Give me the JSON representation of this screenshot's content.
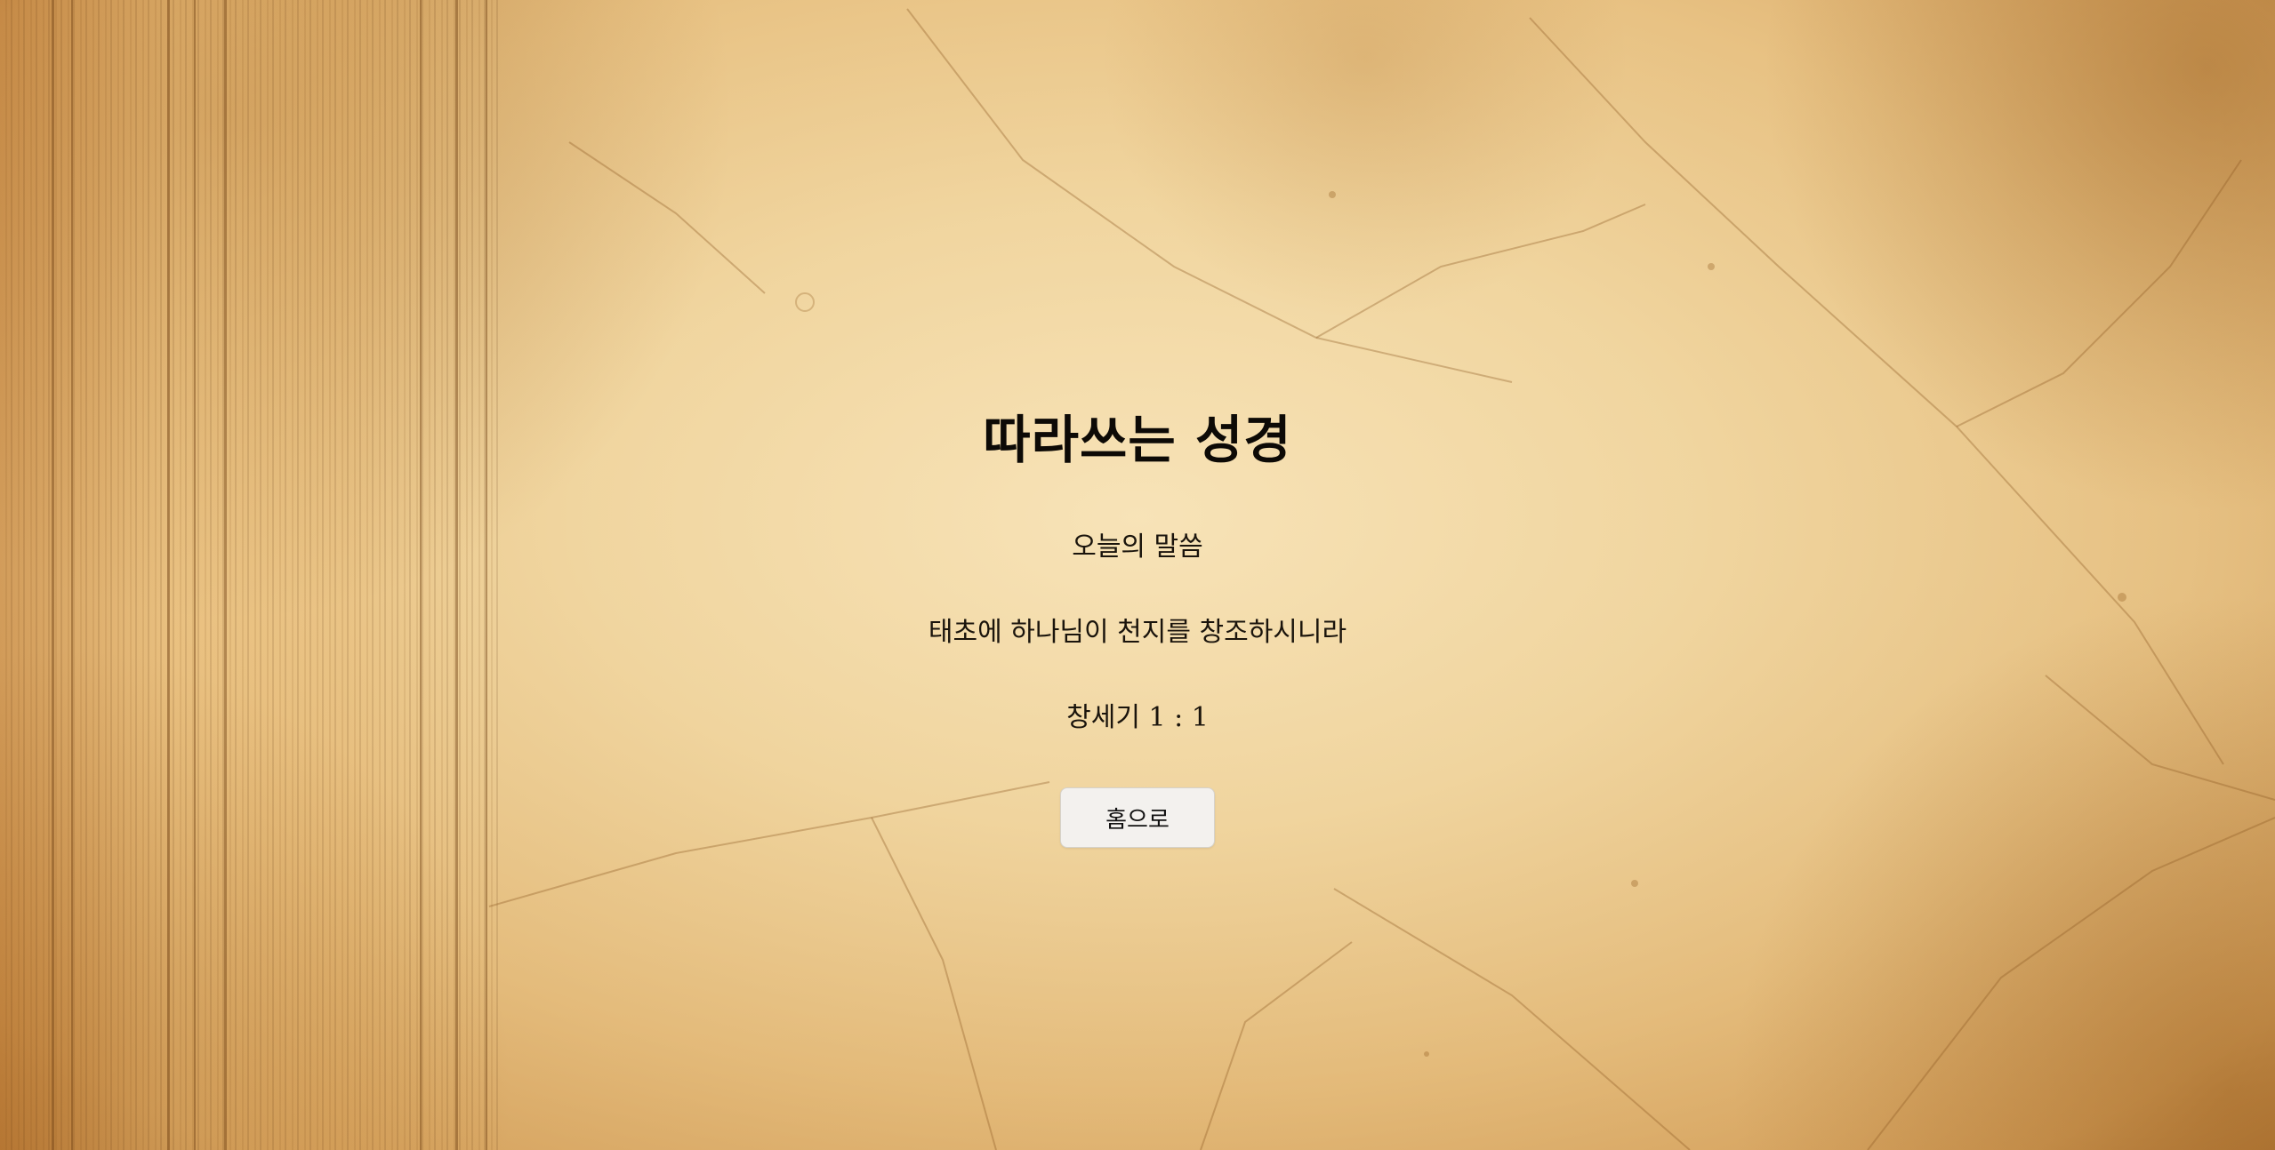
{
  "page": {
    "title": "따라쓰는 성경",
    "subtitle": "오늘의 말씀",
    "verse_text": "태초에 하나님이 천지를 창조하시니라",
    "verse_reference": "창세기 1 : 1",
    "home_button_label": "홈으로"
  },
  "colors": {
    "parchment": "#ecd09a",
    "parchment_edge": "#a8682b",
    "text": "#111111",
    "button_bg": "#f3f1ee"
  }
}
